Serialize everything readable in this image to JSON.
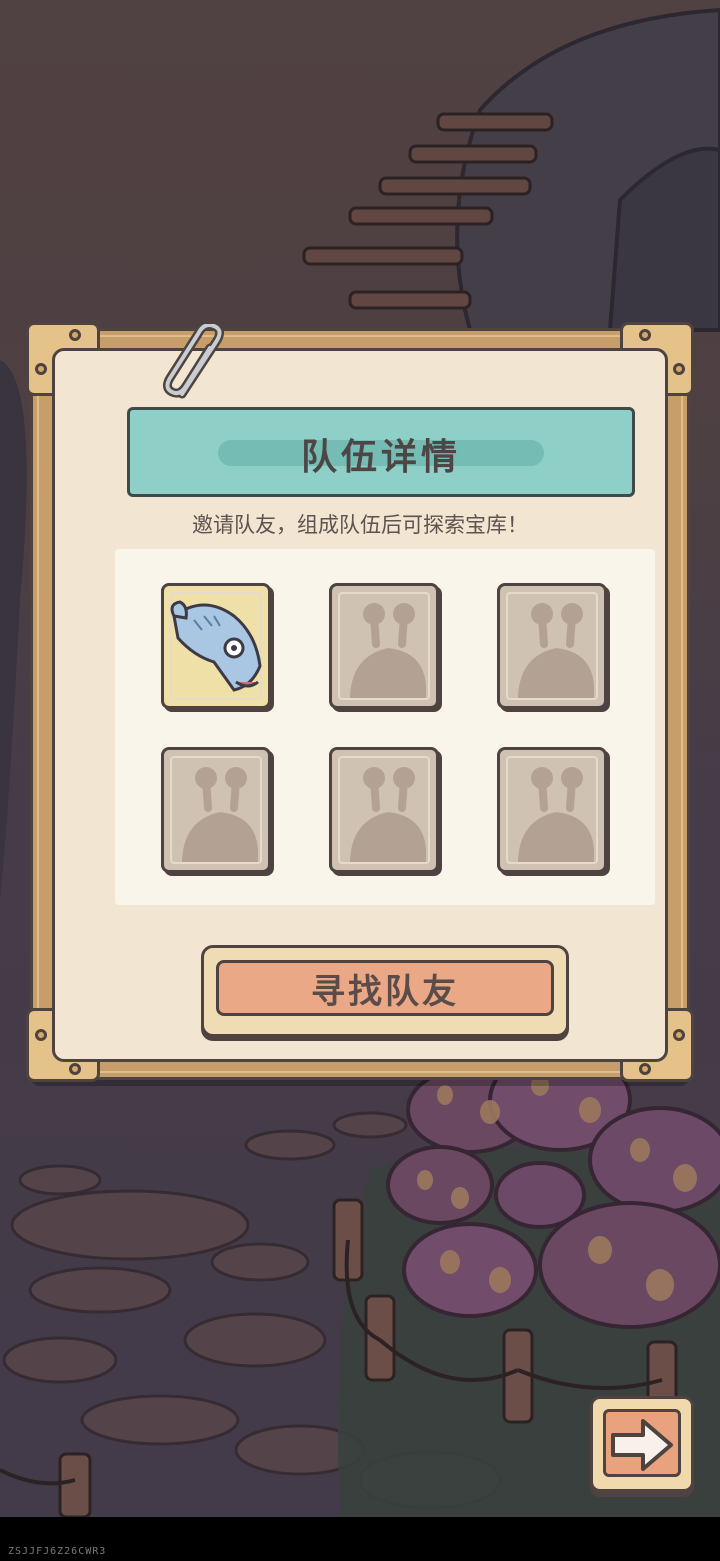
{
  "dialog": {
    "title": "队伍详情",
    "subtitle": "邀请队友，组成队伍后可探索宝库！",
    "find_button_label": "寻找队友"
  },
  "team_slots": [
    {
      "state": "filled",
      "icon": "fish-avatar-icon"
    },
    {
      "state": "empty",
      "icon": "snail-silhouette-icon"
    },
    {
      "state": "empty",
      "icon": "snail-silhouette-icon"
    },
    {
      "state": "empty",
      "icon": "snail-silhouette-icon"
    },
    {
      "state": "empty",
      "icon": "snail-silhouette-icon"
    },
    {
      "state": "empty",
      "icon": "snail-silhouette-icon"
    }
  ],
  "footer": {
    "next_icon": "arrow-right-icon",
    "watermark": "ZSJJFJ6Z26CWR3"
  },
  "colors": {
    "title_bar": "#8ecfc8",
    "frame": "#c79d6a",
    "paper": "#f2e6d2",
    "find_button": "#eba886",
    "outline": "#4e4340"
  }
}
